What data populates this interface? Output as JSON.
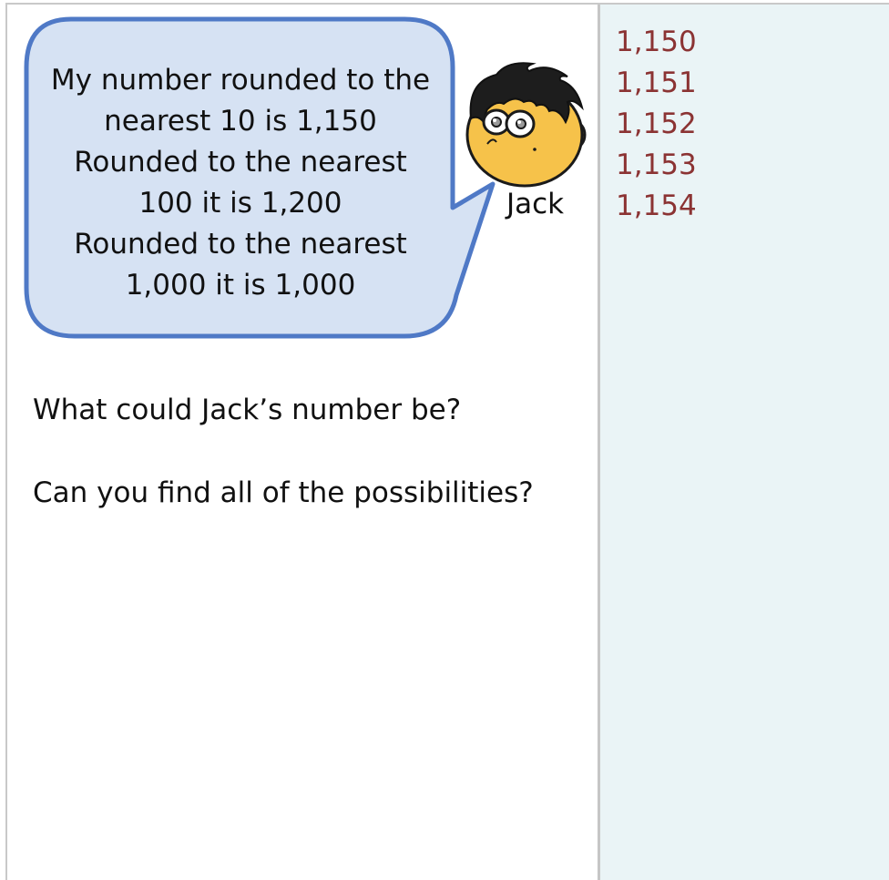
{
  "speech_bubble": {
    "lines": [
      "My number rounded to the",
      "nearest 10 is 1,150",
      "Rounded to the nearest",
      "100 it is 1,200",
      "Rounded to the nearest",
      "1,000 it is 1,000"
    ]
  },
  "character": {
    "name": "Jack"
  },
  "questions": [
    "What could Jack’s number be?",
    "Can you find all of the possibilities?"
  ],
  "answers": [
    "1,150",
    "1,151",
    "1,152",
    "1,153",
    "1,154"
  ],
  "colors": {
    "bubble_fill": "#d6e2f3",
    "bubble_stroke": "#4f79c6",
    "answer_text": "#8b3333",
    "right_panel_bg": "#eaf4f6"
  }
}
